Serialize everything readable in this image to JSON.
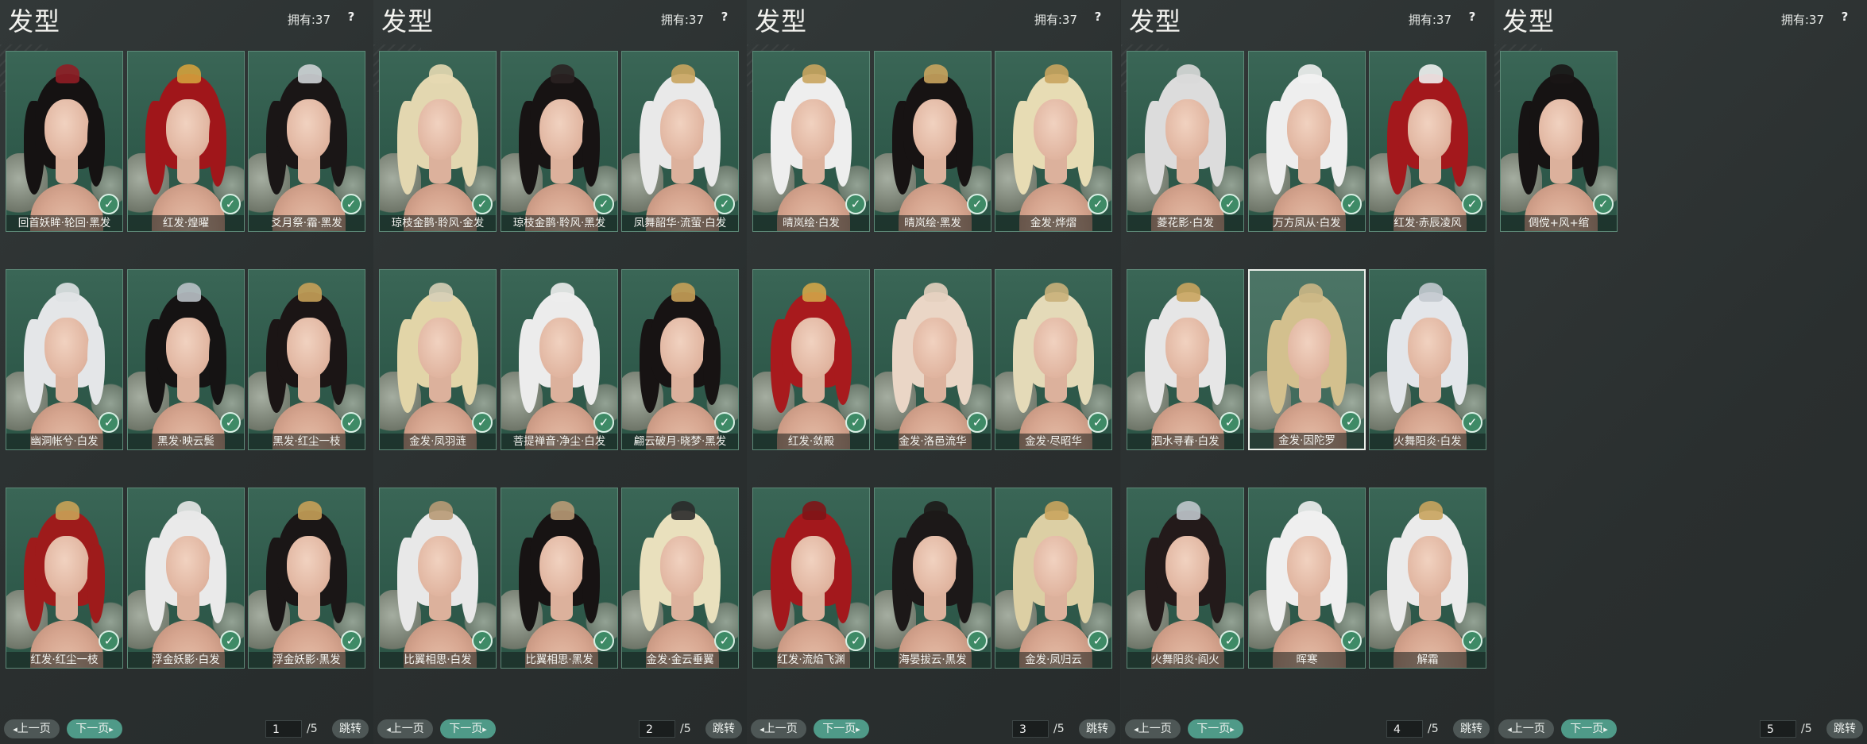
{
  "title": "发型",
  "owned_label": "拥有",
  "owned_count": "37",
  "help_glyph": "?",
  "pagination": {
    "prev": "上一页",
    "next": "下一页",
    "jump": "跳转",
    "total": "/5"
  },
  "check_glyph": "✓",
  "colors": {
    "card_green": "#3a6656",
    "accent": "#4f9a88",
    "panel": "#2b3030"
  },
  "panels": [
    {
      "page": "1",
      "items": [
        {
          "label": "回首妖眸·轮回·黑发",
          "hair": "#151212",
          "orn": "#8f1d25"
        },
        {
          "label": "红发·煌曜",
          "hair": "#a0161a",
          "orn": "#d3a03c"
        },
        {
          "label": "爻月祭·霜·黑发",
          "hair": "#1a1616",
          "orn": "#cfd3d6"
        },
        {
          "label": "幽洞帐兮·白发",
          "hair": "#e4e6e8",
          "orn": "#dfe2e4"
        },
        {
          "label": "黑发·映云鬓",
          "hair": "#151313",
          "orn": "#b9c1c6"
        },
        {
          "label": "黑发·红尘一枝",
          "hair": "#1b1515",
          "orn": "#c7a058"
        },
        {
          "label": "红发·红尘一枝",
          "hair": "#9e1b1b",
          "orn": "#c9a257"
        },
        {
          "label": "浮金妖影·白发",
          "hair": "#eaeaea",
          "orn": "#e8e8e8"
        },
        {
          "label": "浮金妖影·黑发",
          "hair": "#1a1616",
          "orn": "#c7a058"
        }
      ]
    },
    {
      "page": "2",
      "items": [
        {
          "label": "琼枝金鹊·聆风·金发",
          "hair": "#e3d7b0",
          "orn": "#e6d9b3"
        },
        {
          "label": "琼枝金鹊·聆风·黑发",
          "hair": "#171313",
          "orn": "#2a2222"
        },
        {
          "label": "凤舞韶华·流萤·白发",
          "hair": "#e9e9e9",
          "orn": "#c9a45e"
        },
        {
          "label": "金发·凤羽涟",
          "hair": "#e2d5a8",
          "orn": "#d7cfb7"
        },
        {
          "label": "菩提禅音·净尘·白发",
          "hair": "#ececec",
          "orn": "#ededed"
        },
        {
          "label": "翩云破月·晓梦·黑发",
          "hair": "#171313",
          "orn": "#c7a058"
        },
        {
          "label": "比翼相思·白发",
          "hair": "#e8e8e8",
          "orn": "#b89a76"
        },
        {
          "label": "比翼相思·黑发",
          "hair": "#171313",
          "orn": "#b89a76"
        },
        {
          "label": "金发·金云垂翼",
          "hair": "#e9e0bd",
          "orn": "#2a2a2a"
        }
      ]
    },
    {
      "page": "3",
      "items": [
        {
          "label": "晴岚绘·白发",
          "hair": "#eeeeee",
          "orn": "#c9a45e"
        },
        {
          "label": "晴岚绘·黑发",
          "hair": "#171313",
          "orn": "#c9a45e"
        },
        {
          "label": "金发·烨熠",
          "hair": "#e7dcb4",
          "orn": "#c9a45e"
        },
        {
          "label": "红发·敛殿",
          "hair": "#a81a1d",
          "orn": "#d1a548"
        },
        {
          "label": "金发·洛邑流华",
          "hair": "#ead6c6",
          "orn": "#e4d0bf"
        },
        {
          "label": "金发·尽昭华",
          "hair": "#e4dab8",
          "orn": "#c9b07a"
        },
        {
          "label": "红发·流焰飞渊",
          "hair": "#a3181c",
          "orn": "#7f1417"
        },
        {
          "label": "海晏拔云·黑发",
          "hair": "#1c1818",
          "orn": "#1d1a18"
        },
        {
          "label": "金发·凤归云",
          "hair": "#dccfa4",
          "orn": "#c9a45e"
        }
      ]
    },
    {
      "page": "4",
      "items": [
        {
          "label": "菱花影·白发",
          "hair": "#dcdcdc",
          "orn": "#d9d9d9"
        },
        {
          "label": "万方凤从·白发",
          "hair": "#eeeeee",
          "orn": "#f1f1f1"
        },
        {
          "label": "红发·赤辰凌风",
          "hair": "#a3181c",
          "orn": "#efefef"
        },
        {
          "label": "泗水寻春·白发",
          "hair": "#e6e6e6",
          "orn": "#c9a45e"
        },
        {
          "label": "金发·因陀罗",
          "hair": "#d3c08e",
          "orn": "#cbb785",
          "selected": true
        },
        {
          "label": "火舞阳炎·白发",
          "hair": "#e3e6ea",
          "orn": "#c3c9cf"
        },
        {
          "label": "火舞阳炎·阎火",
          "hair": "#231a1a",
          "orn": "#c0c6cc"
        },
        {
          "label": "晖寒",
          "hair": "#efefef",
          "orn": "#f0f0f0"
        },
        {
          "label": "解霜",
          "hair": "#ebebeb",
          "orn": "#c9a45e"
        }
      ]
    },
    {
      "page": "5",
      "items": [
        {
          "label": "倜傥+风+绾",
          "hair": "#161313",
          "orn": "#1a1616"
        }
      ]
    }
  ]
}
